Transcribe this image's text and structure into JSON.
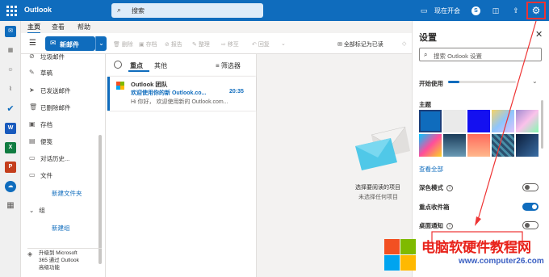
{
  "app": {
    "name": "Outlook",
    "brand_color": "#0f6cbd"
  },
  "search": {
    "placeholder": "搜索"
  },
  "topbar": {
    "meet_now": "现在开会"
  },
  "tabs": [
    "主页",
    "查看",
    "帮助"
  ],
  "ribbon": {
    "new_mail": "新邮件",
    "delete": "删除",
    "archive": "存档",
    "report": "报告",
    "sweep": "整理",
    "move": "移至",
    "reply": "回复",
    "mark_all_read": "全部标记为已读"
  },
  "folders": {
    "items": [
      "垃圾邮件",
      "草稿",
      "已发送邮件",
      "已删除邮件",
      "存档",
      "便笺",
      "对话历史...",
      "文件"
    ],
    "new_folder": "新建文件夹",
    "group_header": "组",
    "new_group": "新建组",
    "upgrade": [
      "升级到 Microsoft",
      "365 通过 Outlook",
      "高级功能"
    ]
  },
  "maillist": {
    "tab_focused": "重点",
    "tab_other": "其他",
    "filter": "筛选器",
    "message": {
      "sender": "Outlook 团队",
      "subject": "欢迎使用你的新 Outlook.co...",
      "time": "20:35",
      "preview": "Hi 你好，  欢迎使用新的 Outlook.com..."
    }
  },
  "reading_pane": {
    "title": "选择要阅读的项目",
    "subtitle": "未选择任何项目"
  },
  "settings": {
    "title": "设置",
    "search_placeholder": "搜索 Outlook 设置",
    "getting_started": "开始使用",
    "theme_label": "主题",
    "view_all": "查看全部",
    "dark_mode": "深色模式",
    "dark_mode_on": false,
    "focused_inbox": "重点收件箱",
    "focused_inbox_on": true,
    "desktop_notifications": "桌面通知",
    "desktop_notifications_on": false
  },
  "watermark": {
    "title": "电脑软硬件教程网",
    "url": "www.computer26.com"
  }
}
